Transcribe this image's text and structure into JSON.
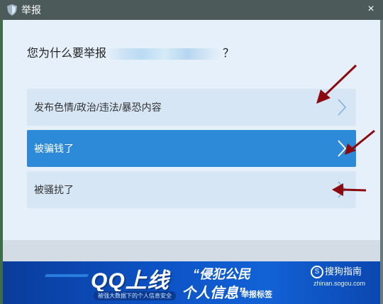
{
  "window": {
    "title": "举报",
    "close_glyph": "×"
  },
  "dialog": {
    "question_prefix": "您为什么要举报",
    "question_suffix": "？",
    "options": [
      {
        "label": "发布色情/政治/违法/暴恐内容",
        "selected": false
      },
      {
        "label": "被骗钱了",
        "selected": true
      },
      {
        "label": "被骚扰了",
        "selected": false
      }
    ]
  },
  "banner": {
    "headline_a": "QQ上线",
    "headline_quote_open": "“",
    "headline_b": "侵犯公民",
    "headline_c": "个人信息",
    "headline_quote_close": "”",
    "headline_d": "举报标签",
    "subtext": "被强大数据下的个人信息安全"
  },
  "watermark": {
    "brand": "搜狗指南",
    "brand_icon_glyph": "S",
    "url": "zhinan.sogou.com"
  },
  "colors": {
    "titlebar": "#4c5b5a",
    "dialog_bg": "#e6f0fa",
    "option_bg": "#d6e6f5",
    "option_selected": "#2d8ad9",
    "annotation_arrow": "#8b0a0f"
  },
  "icons": {
    "title": "shield-icon",
    "close": "close-icon",
    "chevron": "chevron-right-icon",
    "annotation": "red-arrow-annotation"
  }
}
